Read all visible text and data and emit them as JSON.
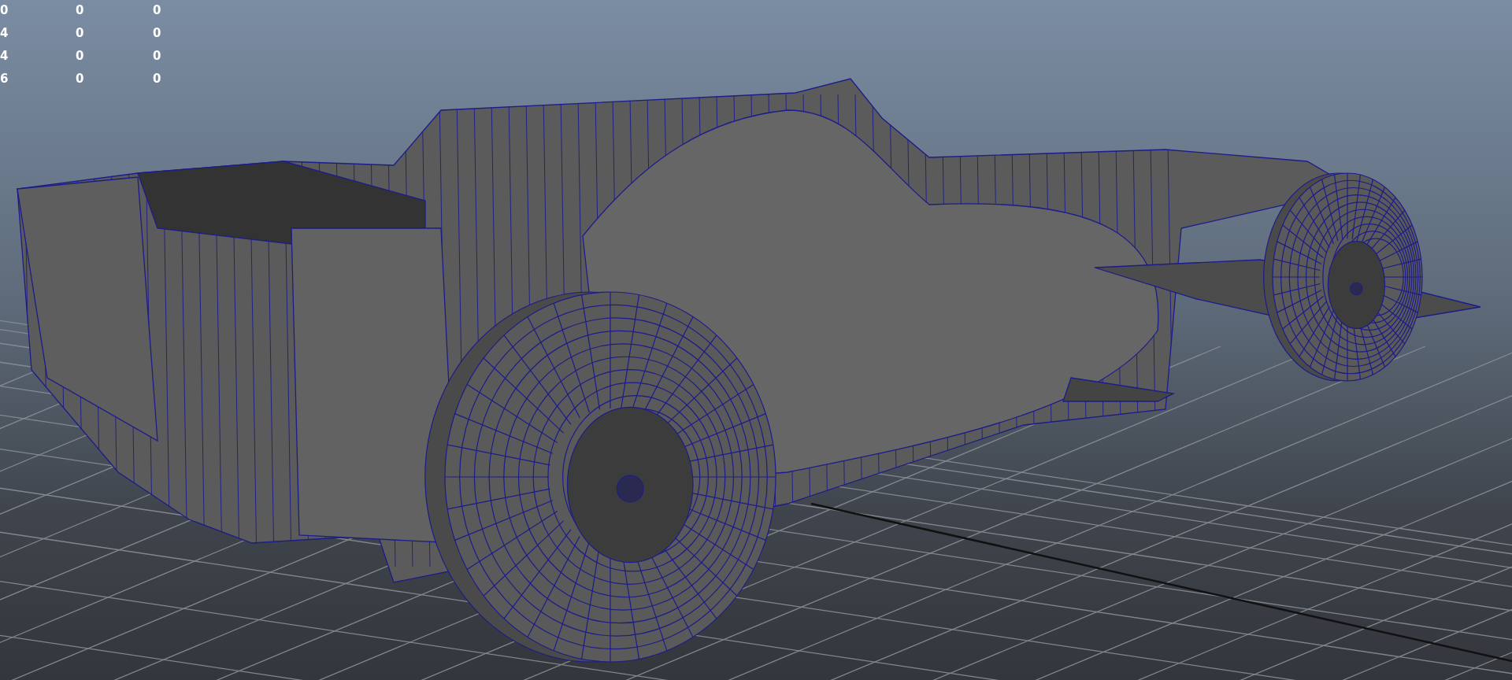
{
  "viewport": {
    "hud_rows": [
      {
        "cells": [
          "0",
          "0",
          "0"
        ]
      },
      {
        "cells": [
          "4",
          "0",
          "0"
        ]
      },
      {
        "cells": [
          "4",
          "0",
          "0"
        ]
      },
      {
        "cells": [
          "6",
          "0",
          "0"
        ]
      }
    ]
  }
}
